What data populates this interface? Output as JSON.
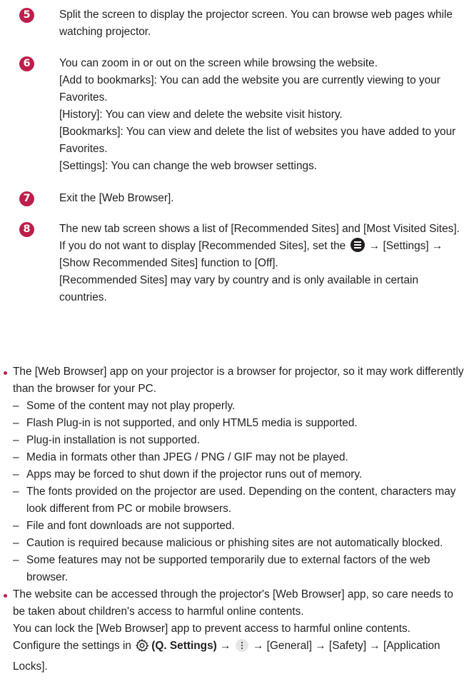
{
  "steps": [
    {
      "number": "5",
      "lines": [
        "Split the screen to display the projector screen. You can browse web pages while watching projector."
      ]
    },
    {
      "number": "6",
      "lines": [
        "You can zoom in or out on the screen while browsing the website.",
        "[Add to bookmarks]: You can add the website you are currently viewing to your Favorites.",
        "[History]: You can view and delete the website visit history.",
        "[Bookmarks]: You can view and delete the list of websites you have added to your Favorites.",
        "[Settings]: You can change the web browser settings."
      ]
    },
    {
      "number": "7",
      "lines": [
        "Exit the [Web Browser]."
      ]
    },
    {
      "number": "8",
      "line1": "The new tab screen shows a list of [Recommended Sites] and [Most Visited Sites].",
      "line2_before": "If you do not want to display [Recommended Sites], set the",
      "line2_after": "→ [Settings] → [Show Recommended Sites] function to [Off].",
      "line3": "[Recommended Sites] may vary by country and is only available in certain countries."
    }
  ],
  "notes": {
    "browser_note": "The [Web Browser] app on your projector is a browser for projector, so it may work differently than the browser for your PC.",
    "dash": "–",
    "sub_items": [
      "Some of the content may not play properly.",
      "Flash Plug-in is not supported, and only HTML5 media is supported.",
      "Plug-in installation is not supported.",
      "Media in formats other than JPEG / PNG / GIF may not be played.",
      "Apps may be forced to shut down if the projector runs out of memory.",
      "The fonts provided on the projector are used. Depending on the content, characters may look different from PC or mobile browsers.",
      "File and font downloads are not supported.",
      "Caution is required because malicious or phishing sites are not automatically blocked.",
      "Some features may not be supported temporarily due to external factors of the web browser."
    ],
    "safety_note": "The website can be accessed through the projector's [Web Browser] app, so care needs to be taken about children's access to harmful online contents.",
    "lock_note": "You can lock the [Web Browser] app to prevent access to harmful online contents.",
    "configure_before": "Configure the settings in",
    "q_settings_label": "(Q. Settings)",
    "arrow": "→",
    "configure_after": "→ [General] → [Safety] → [Application Locks]."
  }
}
